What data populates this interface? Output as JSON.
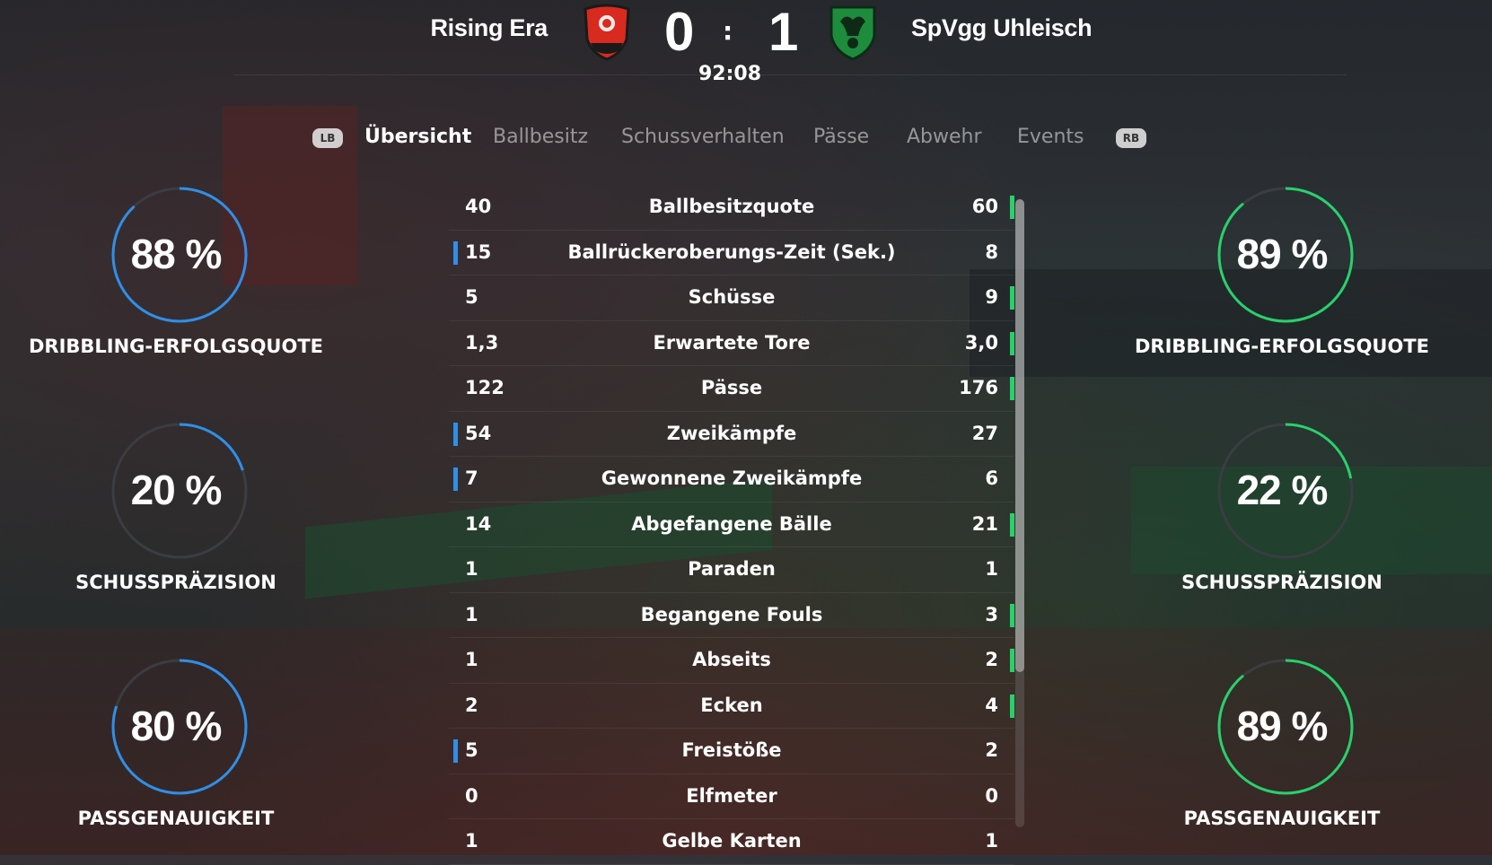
{
  "match": {
    "home_team": "Rising Era",
    "away_team": "SpVgg Uhleisch",
    "home_score": "0",
    "away_score": "1",
    "separator": ":",
    "clock": "92:08"
  },
  "tabs": {
    "lb_hint": "LB",
    "rb_hint": "RB",
    "items": [
      "Übersicht",
      "Ballbesitz",
      "Schussverhalten",
      "Pässe",
      "Abwehr",
      "Events"
    ]
  },
  "stats": [
    {
      "home": "40",
      "label": "Ballbesitzquote",
      "away": "60",
      "leader": "away"
    },
    {
      "home": "15",
      "label": "Ballrückeroberungs-Zeit (Sek.)",
      "away": "8",
      "leader": "home"
    },
    {
      "home": "5",
      "label": "Schüsse",
      "away": "9",
      "leader": "away"
    },
    {
      "home": "1,3",
      "label": "Erwartete Tore",
      "away": "3,0",
      "leader": "away"
    },
    {
      "home": "122",
      "label": "Pässe",
      "away": "176",
      "leader": "away"
    },
    {
      "home": "54",
      "label": "Zweikämpfe",
      "away": "27",
      "leader": "home"
    },
    {
      "home": "7",
      "label": "Gewonnene Zweikämpfe",
      "away": "6",
      "leader": "home"
    },
    {
      "home": "14",
      "label": "Abgefangene Bälle",
      "away": "21",
      "leader": "away"
    },
    {
      "home": "1",
      "label": "Paraden",
      "away": "1",
      "leader": "none"
    },
    {
      "home": "1",
      "label": "Begangene Fouls",
      "away": "3",
      "leader": "away"
    },
    {
      "home": "1",
      "label": "Abseits",
      "away": "2",
      "leader": "away"
    },
    {
      "home": "2",
      "label": "Ecken",
      "away": "4",
      "leader": "away"
    },
    {
      "home": "5",
      "label": "Freistöße",
      "away": "2",
      "leader": "home"
    },
    {
      "home": "0",
      "label": "Elfmeter",
      "away": "0",
      "leader": "none"
    },
    {
      "home": "1",
      "label": "Gelbe Karten",
      "away": "1",
      "leader": "none"
    }
  ],
  "gauges": {
    "home": [
      {
        "value": 88,
        "text": "88 %",
        "label": "DRIBBLING-ERFOLGSQUOTE"
      },
      {
        "value": 20,
        "text": "20 %",
        "label": "SCHUSSPRÄZISION"
      },
      {
        "value": 80,
        "text": "80 %",
        "label": "PASSGENAUIGKEIT"
      }
    ],
    "away": [
      {
        "value": 89,
        "text": "89 %",
        "label": "DRIBBLING-ERFOLGSQUOTE"
      },
      {
        "value": 22,
        "text": "22 %",
        "label": "SCHUSSPRÄZISION"
      },
      {
        "value": 89,
        "text": "89 %",
        "label": "PASSGENAUIGKEIT"
      }
    ]
  },
  "colors": {
    "home_accent": "#2f8fe8",
    "away_accent": "#28d16b",
    "track": "#3a3d42"
  },
  "icons": {
    "home_crest": "rising-era-crest",
    "away_crest": "spvgg-uhleisch-crest"
  }
}
